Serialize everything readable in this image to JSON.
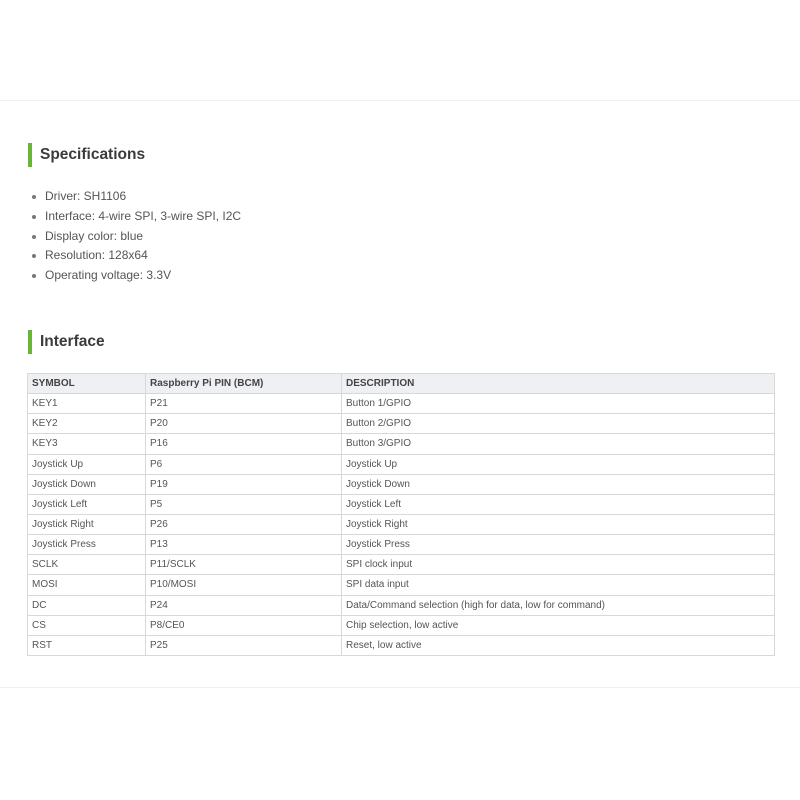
{
  "specifications": {
    "heading": "Specifications",
    "items": [
      "Driver: SH1106",
      "Interface: 4-wire SPI, 3-wire SPI, I2C",
      "Display color: blue",
      "Resolution: 128x64",
      "Operating voltage: 3.3V"
    ]
  },
  "interface": {
    "heading": "Interface",
    "columns": [
      "SYMBOL",
      "Raspberry Pi PIN (BCM)",
      "DESCRIPTION"
    ],
    "rows": [
      [
        "KEY1",
        "P21",
        "Button 1/GPIO"
      ],
      [
        "KEY2",
        "P20",
        "Button 2/GPIO"
      ],
      [
        "KEY3",
        "P16",
        "Button 3/GPIO"
      ],
      [
        "Joystick Up",
        "P6",
        "Joystick Up"
      ],
      [
        "Joystick Down",
        "P19",
        "Joystick Down"
      ],
      [
        "Joystick Left",
        "P5",
        "Joystick Left"
      ],
      [
        "Joystick Right",
        "P26",
        "Joystick Right"
      ],
      [
        "Joystick Press",
        "P13",
        "Joystick Press"
      ],
      [
        "SCLK",
        "P11/SCLK",
        "SPI clock input"
      ],
      [
        "MOSI",
        "P10/MOSI",
        "SPI data input"
      ],
      [
        "DC",
        "P24",
        "Data/Command selection (high for data, low for command)"
      ],
      [
        "CS",
        "P8/CE0",
        "Chip selection, low active"
      ],
      [
        "RST",
        "P25",
        "Reset, low active"
      ]
    ]
  },
  "colors": {
    "accent": "#6ab43a",
    "header_bg": "#eef0f3",
    "border": "#d8d8d8",
    "text": "#555555"
  }
}
